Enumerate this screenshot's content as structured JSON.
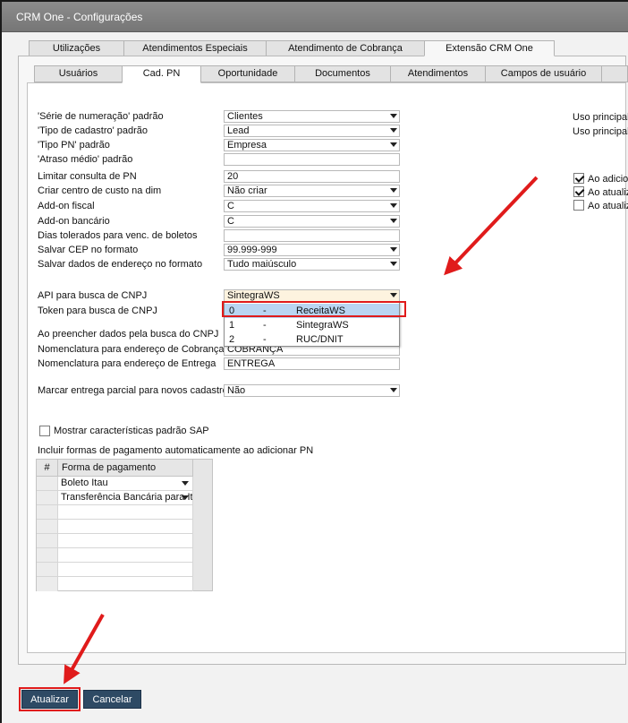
{
  "window": {
    "title": "CRM One - Configurações"
  },
  "outer_tabs": [
    {
      "label": "Utilizações"
    },
    {
      "label": "Atendimentos Especiais"
    },
    {
      "label": "Atendimento de Cobrança"
    },
    {
      "label": "Extensão CRM One",
      "active": true
    }
  ],
  "inner_tabs": [
    {
      "label": "Usuários"
    },
    {
      "label": "Cad. PN",
      "active": true
    },
    {
      "label": "Oportunidade"
    },
    {
      "label": "Documentos"
    },
    {
      "label": "Atendimentos"
    },
    {
      "label": "Campos de usuário"
    }
  ],
  "form": {
    "serie_label": "'Série de numeração' padrão",
    "serie_value": "Clientes",
    "tipo_cadastro_label": "'Tipo de cadastro' padrão",
    "tipo_cadastro_value": "Lead",
    "tipo_pn_label": "'Tipo PN' padrão",
    "tipo_pn_value": "Empresa",
    "atraso_label": "'Atraso médio' padrão",
    "atraso_value": "",
    "limitar_label": "Limitar consulta de PN",
    "limitar_value": "20",
    "centro_custo_label": "Criar centro de custo na dim",
    "centro_custo_value": "Não criar",
    "addon_fiscal_label": "Add-on fiscal",
    "addon_fiscal_value": "C",
    "addon_bancario_label": "Add-on bancário",
    "addon_bancario_value": "C",
    "dias_label": "Dias tolerados para venc. de boletos",
    "dias_value": "",
    "cep_label": "Salvar CEP no formato",
    "cep_value": "99.999-999",
    "endereco_label": "Salvar dados de endereço no formato",
    "endereco_value": "Tudo maiúsculo",
    "api_label": "API para busca de CNPJ",
    "api_value": "SintegraWS",
    "token_label": "Token para busca de CNPJ",
    "preencher_label": "Ao preencher dados pela busca do CNPJ",
    "nom_cobranca_label": "Nomenclatura para endereço de Cobrança",
    "nom_cobranca_value": "COBRANÇA",
    "nom_entrega_label": "Nomenclatura para endereço de Entrega",
    "nom_entrega_value": "ENTREGA",
    "marcar_label": "Marcar entrega parcial para novos cadastros",
    "marcar_value": "Não",
    "mostrar_label": "Mostrar características padrão SAP",
    "incluir_label": "Incluir formas de pagamento automaticamente ao adicionar PN"
  },
  "api_dropdown": [
    {
      "code": "0",
      "sep": "-",
      "name": "ReceitaWS",
      "selected": true
    },
    {
      "code": "1",
      "sep": "-",
      "name": "SintegraWS"
    },
    {
      "code": "2",
      "sep": "-",
      "name": "RUC/DNIT"
    }
  ],
  "right_panel": {
    "uso1": "Uso principal",
    "uso2": "Uso principal",
    "chk1_label": "Ao adicio",
    "chk1_checked": true,
    "chk2_label": "Ao atualiz",
    "chk2_checked": true,
    "chk3_label": "Ao atualiz",
    "chk3_checked": false
  },
  "payment_grid": {
    "col_num": "#",
    "col_forma": "Forma de pagamento",
    "rows": [
      "Boleto Itau",
      "Transferência Bancária para It",
      "",
      "",
      "",
      "",
      "",
      ""
    ]
  },
  "buttons": {
    "update": "Atualizar",
    "cancel": "Cancelar"
  },
  "colors": {
    "highlight": "#e01b1b",
    "button": "#2e4a64",
    "dropdown_selected": "#b9d5f2"
  }
}
